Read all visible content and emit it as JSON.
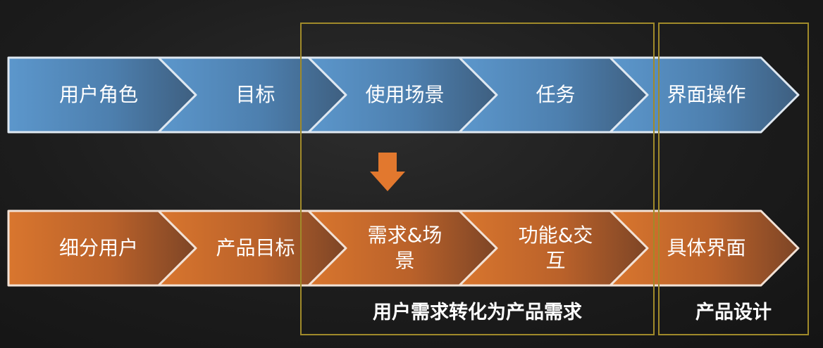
{
  "colors": {
    "blue_row": "#5a8fc0",
    "orange_row": "#c76a2a",
    "frame": "#a08a2a",
    "arrow": "#e2782e"
  },
  "top_row": [
    {
      "label": "用户角色"
    },
    {
      "label": "目标"
    },
    {
      "label": "使用场景"
    },
    {
      "label": "任务"
    },
    {
      "label": "界面操作"
    }
  ],
  "bottom_row": [
    {
      "label": "细分用户"
    },
    {
      "label": "产品目标"
    },
    {
      "label": "需求&场\n景"
    },
    {
      "label": "功能&交\n互"
    },
    {
      "label": "具体界面"
    }
  ],
  "down_arrow_icon": "arrow-down-icon",
  "groups": {
    "requirements": "用户需求转化为产品需求",
    "design": "产品设计"
  }
}
